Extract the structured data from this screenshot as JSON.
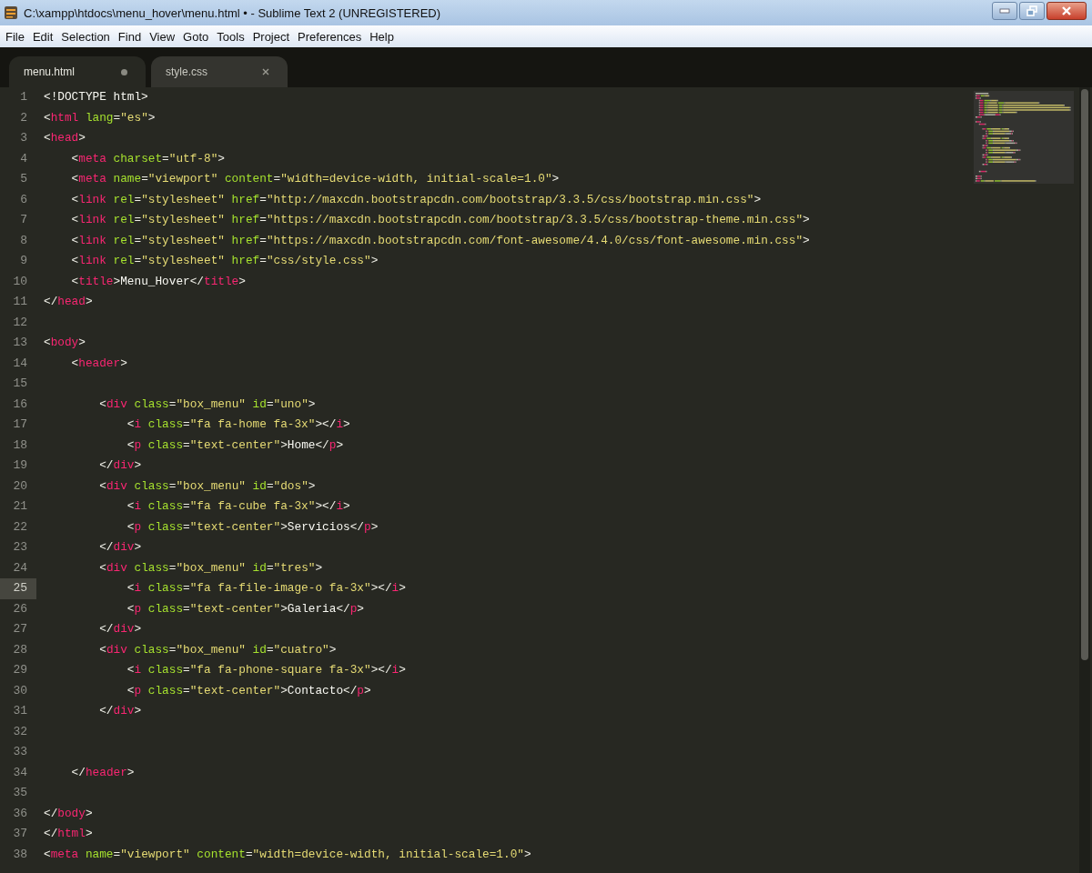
{
  "window": {
    "title": "C:\\xampp\\htdocs\\menu_hover\\menu.html • - Sublime Text 2 (UNREGISTERED)"
  },
  "menu": [
    "File",
    "Edit",
    "Selection",
    "Find",
    "View",
    "Goto",
    "Tools",
    "Project",
    "Preferences",
    "Help"
  ],
  "tabs": [
    {
      "label": "menu.html",
      "selected": true,
      "modified": true
    },
    {
      "label": "style.css",
      "selected": false,
      "modified": false
    }
  ],
  "lines": [
    {
      "number": "1",
      "current": false,
      "tokens": [
        {
          "kind": "text",
          "text": "<!DOCTYPE html>"
        }
      ]
    },
    {
      "number": "2",
      "current": false,
      "tokens": [
        {
          "kind": "punct",
          "text": "<"
        },
        {
          "kind": "tag",
          "text": "html"
        },
        {
          "kind": "attr",
          "text": " lang"
        },
        {
          "kind": "punct",
          "text": "="
        },
        {
          "kind": "string",
          "text": "\"es\""
        },
        {
          "kind": "punct",
          "text": ">"
        }
      ]
    },
    {
      "number": "3",
      "current": false,
      "tokens": [
        {
          "kind": "punct",
          "text": "<"
        },
        {
          "kind": "tag",
          "text": "head"
        },
        {
          "kind": "punct",
          "text": ">"
        }
      ]
    },
    {
      "number": "4",
      "current": false,
      "tokens": [
        {
          "kind": "punct",
          "text": "    <"
        },
        {
          "kind": "tag",
          "text": "meta"
        },
        {
          "kind": "attr",
          "text": " charset"
        },
        {
          "kind": "punct",
          "text": "="
        },
        {
          "kind": "string",
          "text": "\"utf-8\""
        },
        {
          "kind": "punct",
          "text": ">"
        }
      ]
    },
    {
      "number": "5",
      "current": false,
      "tokens": [
        {
          "kind": "punct",
          "text": "    <"
        },
        {
          "kind": "tag",
          "text": "meta"
        },
        {
          "kind": "attr",
          "text": " name"
        },
        {
          "kind": "punct",
          "text": "="
        },
        {
          "kind": "string",
          "text": "\"viewport\""
        },
        {
          "kind": "attr",
          "text": " content"
        },
        {
          "kind": "punct",
          "text": "="
        },
        {
          "kind": "string",
          "text": "\"width=device-width, initial-scale=1.0\""
        },
        {
          "kind": "punct",
          "text": ">"
        }
      ]
    },
    {
      "number": "6",
      "current": false,
      "tokens": [
        {
          "kind": "punct",
          "text": "    <"
        },
        {
          "kind": "tag",
          "text": "link"
        },
        {
          "kind": "attr",
          "text": " rel"
        },
        {
          "kind": "punct",
          "text": "="
        },
        {
          "kind": "string",
          "text": "\"stylesheet\""
        },
        {
          "kind": "attr",
          "text": " href"
        },
        {
          "kind": "punct",
          "text": "="
        },
        {
          "kind": "string",
          "text": "\"http://maxcdn.bootstrapcdn.com/bootstrap/3.3.5/css/bootstrap.min.css\""
        },
        {
          "kind": "punct",
          "text": ">"
        }
      ]
    },
    {
      "number": "7",
      "current": false,
      "tokens": [
        {
          "kind": "punct",
          "text": "    <"
        },
        {
          "kind": "tag",
          "text": "link"
        },
        {
          "kind": "attr",
          "text": " rel"
        },
        {
          "kind": "punct",
          "text": "="
        },
        {
          "kind": "string",
          "text": "\"stylesheet\""
        },
        {
          "kind": "attr",
          "text": " href"
        },
        {
          "kind": "punct",
          "text": "="
        },
        {
          "kind": "string",
          "text": "\"https://maxcdn.bootstrapcdn.com/bootstrap/3.3.5/css/bootstrap-theme.min.css\""
        },
        {
          "kind": "punct",
          "text": ">"
        }
      ]
    },
    {
      "number": "8",
      "current": false,
      "tokens": [
        {
          "kind": "punct",
          "text": "    <"
        },
        {
          "kind": "tag",
          "text": "link"
        },
        {
          "kind": "attr",
          "text": " rel"
        },
        {
          "kind": "punct",
          "text": "="
        },
        {
          "kind": "string",
          "text": "\"stylesheet\""
        },
        {
          "kind": "attr",
          "text": " href"
        },
        {
          "kind": "punct",
          "text": "="
        },
        {
          "kind": "string",
          "text": "\"https://maxcdn.bootstrapcdn.com/font-awesome/4.4.0/css/font-awesome.min.css\""
        },
        {
          "kind": "punct",
          "text": ">"
        }
      ]
    },
    {
      "number": "9",
      "current": false,
      "tokens": [
        {
          "kind": "punct",
          "text": "    <"
        },
        {
          "kind": "tag",
          "text": "link"
        },
        {
          "kind": "attr",
          "text": " rel"
        },
        {
          "kind": "punct",
          "text": "="
        },
        {
          "kind": "string",
          "text": "\"stylesheet\""
        },
        {
          "kind": "attr",
          "text": " href"
        },
        {
          "kind": "punct",
          "text": "="
        },
        {
          "kind": "string",
          "text": "\"css/style.css\""
        },
        {
          "kind": "punct",
          "text": ">"
        }
      ]
    },
    {
      "number": "10",
      "current": false,
      "tokens": [
        {
          "kind": "punct",
          "text": "    <"
        },
        {
          "kind": "tag",
          "text": "title"
        },
        {
          "kind": "punct",
          "text": ">"
        },
        {
          "kind": "text",
          "text": "Menu_Hover"
        },
        {
          "kind": "punct",
          "text": "</"
        },
        {
          "kind": "tag",
          "text": "title"
        },
        {
          "kind": "punct",
          "text": ">"
        }
      ]
    },
    {
      "number": "11",
      "current": false,
      "tokens": [
        {
          "kind": "punct",
          "text": "</"
        },
        {
          "kind": "tag",
          "text": "head"
        },
        {
          "kind": "punct",
          "text": ">"
        }
      ]
    },
    {
      "number": "12",
      "current": false
    },
    {
      "number": "13",
      "current": false,
      "tokens": [
        {
          "kind": "punct",
          "text": "<"
        },
        {
          "kind": "tag",
          "text": "body"
        },
        {
          "kind": "punct",
          "text": ">"
        }
      ]
    },
    {
      "number": "14",
      "current": false,
      "tokens": [
        {
          "kind": "punct",
          "text": "    <"
        },
        {
          "kind": "tag",
          "text": "header"
        },
        {
          "kind": "punct",
          "text": ">"
        }
      ]
    },
    {
      "number": "15",
      "current": false
    },
    {
      "number": "16",
      "current": false,
      "tokens": [
        {
          "kind": "punct",
          "text": "        <"
        },
        {
          "kind": "tag",
          "text": "div"
        },
        {
          "kind": "attr",
          "text": " class"
        },
        {
          "kind": "punct",
          "text": "="
        },
        {
          "kind": "string",
          "text": "\"box_menu\""
        },
        {
          "kind": "attr",
          "text": " id"
        },
        {
          "kind": "punct",
          "text": "="
        },
        {
          "kind": "string",
          "text": "\"uno\""
        },
        {
          "kind": "punct",
          "text": ">"
        }
      ]
    },
    {
      "number": "17",
      "current": false,
      "tokens": [
        {
          "kind": "punct",
          "text": "            <"
        },
        {
          "kind": "tag",
          "text": "i"
        },
        {
          "kind": "attr",
          "text": " class"
        },
        {
          "kind": "punct",
          "text": "="
        },
        {
          "kind": "string",
          "text": "\"fa fa-home fa-3x\""
        },
        {
          "kind": "punct",
          "text": "></"
        },
        {
          "kind": "tag",
          "text": "i"
        },
        {
          "kind": "punct",
          "text": ">"
        }
      ]
    },
    {
      "number": "18",
      "current": false,
      "tokens": [
        {
          "kind": "punct",
          "text": "            <"
        },
        {
          "kind": "tag",
          "text": "p"
        },
        {
          "kind": "attr",
          "text": " class"
        },
        {
          "kind": "punct",
          "text": "="
        },
        {
          "kind": "string",
          "text": "\"text-center\""
        },
        {
          "kind": "punct",
          "text": ">"
        },
        {
          "kind": "text",
          "text": "Home"
        },
        {
          "kind": "punct",
          "text": "</"
        },
        {
          "kind": "tag",
          "text": "p"
        },
        {
          "kind": "punct",
          "text": ">"
        }
      ]
    },
    {
      "number": "19",
      "current": false,
      "tokens": [
        {
          "kind": "punct",
          "text": "        </"
        },
        {
          "kind": "tag",
          "text": "div"
        },
        {
          "kind": "punct",
          "text": ">"
        }
      ]
    },
    {
      "number": "20",
      "current": false,
      "tokens": [
        {
          "kind": "punct",
          "text": "        <"
        },
        {
          "kind": "tag",
          "text": "div"
        },
        {
          "kind": "attr",
          "text": " class"
        },
        {
          "kind": "punct",
          "text": "="
        },
        {
          "kind": "string",
          "text": "\"box_menu\""
        },
        {
          "kind": "attr",
          "text": " id"
        },
        {
          "kind": "punct",
          "text": "="
        },
        {
          "kind": "string",
          "text": "\"dos\""
        },
        {
          "kind": "punct",
          "text": ">"
        }
      ]
    },
    {
      "number": "21",
      "current": false,
      "tokens": [
        {
          "kind": "punct",
          "text": "            <"
        },
        {
          "kind": "tag",
          "text": "i"
        },
        {
          "kind": "attr",
          "text": " class"
        },
        {
          "kind": "punct",
          "text": "="
        },
        {
          "kind": "string",
          "text": "\"fa fa-cube fa-3x\""
        },
        {
          "kind": "punct",
          "text": "></"
        },
        {
          "kind": "tag",
          "text": "i"
        },
        {
          "kind": "punct",
          "text": ">"
        }
      ]
    },
    {
      "number": "22",
      "current": false,
      "tokens": [
        {
          "kind": "punct",
          "text": "            <"
        },
        {
          "kind": "tag",
          "text": "p"
        },
        {
          "kind": "attr",
          "text": " class"
        },
        {
          "kind": "punct",
          "text": "="
        },
        {
          "kind": "string",
          "text": "\"text-center\""
        },
        {
          "kind": "punct",
          "text": ">"
        },
        {
          "kind": "text",
          "text": "Servicios"
        },
        {
          "kind": "punct",
          "text": "</"
        },
        {
          "kind": "tag",
          "text": "p"
        },
        {
          "kind": "punct",
          "text": ">"
        }
      ]
    },
    {
      "number": "23",
      "current": false,
      "tokens": [
        {
          "kind": "punct",
          "text": "        </"
        },
        {
          "kind": "tag",
          "text": "div"
        },
        {
          "kind": "punct",
          "text": ">"
        }
      ]
    },
    {
      "number": "24",
      "current": false,
      "tokens": [
        {
          "kind": "punct",
          "text": "        <"
        },
        {
          "kind": "tag",
          "text": "div"
        },
        {
          "kind": "attr",
          "text": " class"
        },
        {
          "kind": "punct",
          "text": "="
        },
        {
          "kind": "string",
          "text": "\"box_menu\""
        },
        {
          "kind": "attr",
          "text": " id"
        },
        {
          "kind": "punct",
          "text": "="
        },
        {
          "kind": "string",
          "text": "\"tres\""
        },
        {
          "kind": "punct",
          "text": ">"
        }
      ]
    },
    {
      "number": "25",
      "current": true,
      "tokens": [
        {
          "kind": "punct",
          "text": "            <"
        },
        {
          "kind": "tag",
          "text": "i"
        },
        {
          "kind": "attr",
          "text": " class"
        },
        {
          "kind": "punct",
          "text": "="
        },
        {
          "kind": "string",
          "text": "\"fa fa-file-image-o fa-3x\""
        },
        {
          "kind": "punct",
          "text": "></"
        },
        {
          "kind": "tag",
          "text": "i"
        },
        {
          "kind": "punct",
          "text": ">"
        }
      ]
    },
    {
      "number": "26",
      "current": false,
      "tokens": [
        {
          "kind": "punct",
          "text": "            <"
        },
        {
          "kind": "tag",
          "text": "p"
        },
        {
          "kind": "attr",
          "text": " class"
        },
        {
          "kind": "punct",
          "text": "="
        },
        {
          "kind": "string",
          "text": "\"text-center\""
        },
        {
          "kind": "punct",
          "text": ">"
        },
        {
          "kind": "text",
          "text": "Galeria"
        },
        {
          "kind": "punct",
          "text": "</"
        },
        {
          "kind": "tag",
          "text": "p"
        },
        {
          "kind": "punct",
          "text": ">"
        }
      ]
    },
    {
      "number": "27",
      "current": false,
      "tokens": [
        {
          "kind": "punct",
          "text": "        </"
        },
        {
          "kind": "tag",
          "text": "div"
        },
        {
          "kind": "punct",
          "text": ">"
        }
      ]
    },
    {
      "number": "28",
      "current": false,
      "tokens": [
        {
          "kind": "punct",
          "text": "        <"
        },
        {
          "kind": "tag",
          "text": "div"
        },
        {
          "kind": "attr",
          "text": " class"
        },
        {
          "kind": "punct",
          "text": "="
        },
        {
          "kind": "string",
          "text": "\"box_menu\""
        },
        {
          "kind": "attr",
          "text": " id"
        },
        {
          "kind": "punct",
          "text": "="
        },
        {
          "kind": "string",
          "text": "\"cuatro\""
        },
        {
          "kind": "punct",
          "text": ">"
        }
      ]
    },
    {
      "number": "29",
      "current": false,
      "tokens": [
        {
          "kind": "punct",
          "text": "            <"
        },
        {
          "kind": "tag",
          "text": "i"
        },
        {
          "kind": "attr",
          "text": " class"
        },
        {
          "kind": "punct",
          "text": "="
        },
        {
          "kind": "string",
          "text": "\"fa fa-phone-square fa-3x\""
        },
        {
          "kind": "punct",
          "text": "></"
        },
        {
          "kind": "tag",
          "text": "i"
        },
        {
          "kind": "punct",
          "text": ">"
        }
      ]
    },
    {
      "number": "30",
      "current": false,
      "tokens": [
        {
          "kind": "punct",
          "text": "            <"
        },
        {
          "kind": "tag",
          "text": "p"
        },
        {
          "kind": "attr",
          "text": " class"
        },
        {
          "kind": "punct",
          "text": "="
        },
        {
          "kind": "string",
          "text": "\"text-center\""
        },
        {
          "kind": "punct",
          "text": ">"
        },
        {
          "kind": "text",
          "text": "Contacto"
        },
        {
          "kind": "punct",
          "text": "</"
        },
        {
          "kind": "tag",
          "text": "p"
        },
        {
          "kind": "punct",
          "text": ">"
        }
      ]
    },
    {
      "number": "31",
      "current": false,
      "tokens": [
        {
          "kind": "punct",
          "text": "        </"
        },
        {
          "kind": "tag",
          "text": "div"
        },
        {
          "kind": "punct",
          "text": ">"
        }
      ]
    },
    {
      "number": "32",
      "current": false
    },
    {
      "number": "33",
      "current": false
    },
    {
      "number": "34",
      "current": false,
      "tokens": [
        {
          "kind": "punct",
          "text": "    </"
        },
        {
          "kind": "tag",
          "text": "header"
        },
        {
          "kind": "punct",
          "text": ">"
        }
      ]
    },
    {
      "number": "35",
      "current": false
    },
    {
      "number": "36",
      "current": false,
      "tokens": [
        {
          "kind": "punct",
          "text": "</"
        },
        {
          "kind": "tag",
          "text": "body"
        },
        {
          "kind": "punct",
          "text": ">"
        }
      ]
    },
    {
      "number": "37",
      "current": false,
      "tokens": [
        {
          "kind": "punct",
          "text": "</"
        },
        {
          "kind": "tag",
          "text": "html"
        },
        {
          "kind": "punct",
          "text": ">"
        }
      ]
    },
    {
      "number": "38",
      "current": false,
      "tokens": [
        {
          "kind": "punct",
          "text": "<"
        },
        {
          "kind": "tag",
          "text": "meta"
        },
        {
          "kind": "attr",
          "text": " name"
        },
        {
          "kind": "punct",
          "text": "="
        },
        {
          "kind": "string",
          "text": "\"viewport\""
        },
        {
          "kind": "attr",
          "text": " content"
        },
        {
          "kind": "punct",
          "text": "="
        },
        {
          "kind": "string",
          "text": "\"width=device-width, initial-scale=1.0\""
        },
        {
          "kind": "punct",
          "text": ">"
        }
      ]
    }
  ]
}
